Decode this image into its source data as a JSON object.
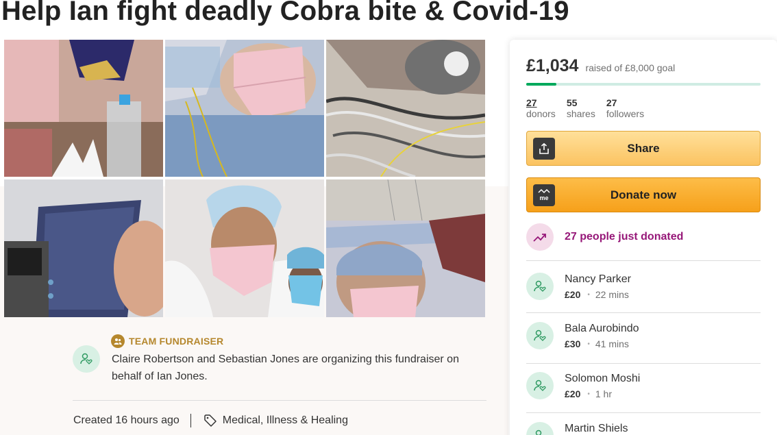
{
  "page": {
    "title": "Help Ian fight deadly Cobra bite & Covid-19"
  },
  "organizer": {
    "badge": "TEAM FUNDRAISER",
    "text": "Claire Robertson and Sebastian Jones are organizing this fundraiser on behalf of Ian Jones.",
    "created": "Created 16 hours ago",
    "category": "Medical, Illness & Healing"
  },
  "donation": {
    "raised": "£1,034",
    "goal_text": "raised of £8,000 goal",
    "progress_fraction": 0.129,
    "stats": [
      {
        "num": "27",
        "label": "donors"
      },
      {
        "num": "55",
        "label": "shares"
      },
      {
        "num": "27",
        "label": "followers"
      }
    ],
    "share_label": "Share",
    "donate_label": "Donate now",
    "donate_icon_text": "me",
    "recent_text": "27 people just donated",
    "donors": [
      {
        "name": "Nancy Parker",
        "amount": "£20",
        "time": "22 mins"
      },
      {
        "name": "Bala Aurobindo",
        "amount": "£30",
        "time": "41 mins"
      },
      {
        "name": "Solomon Moshi",
        "amount": "£20",
        "time": "1 hr"
      },
      {
        "name": "Martin Shiels",
        "amount": "",
        "time": ""
      }
    ]
  },
  "colors": {
    "accent_green": "#02a95c",
    "team_gold": "#b5872d",
    "recent_purple": "#961778",
    "button_orange": "#f6a01a"
  }
}
